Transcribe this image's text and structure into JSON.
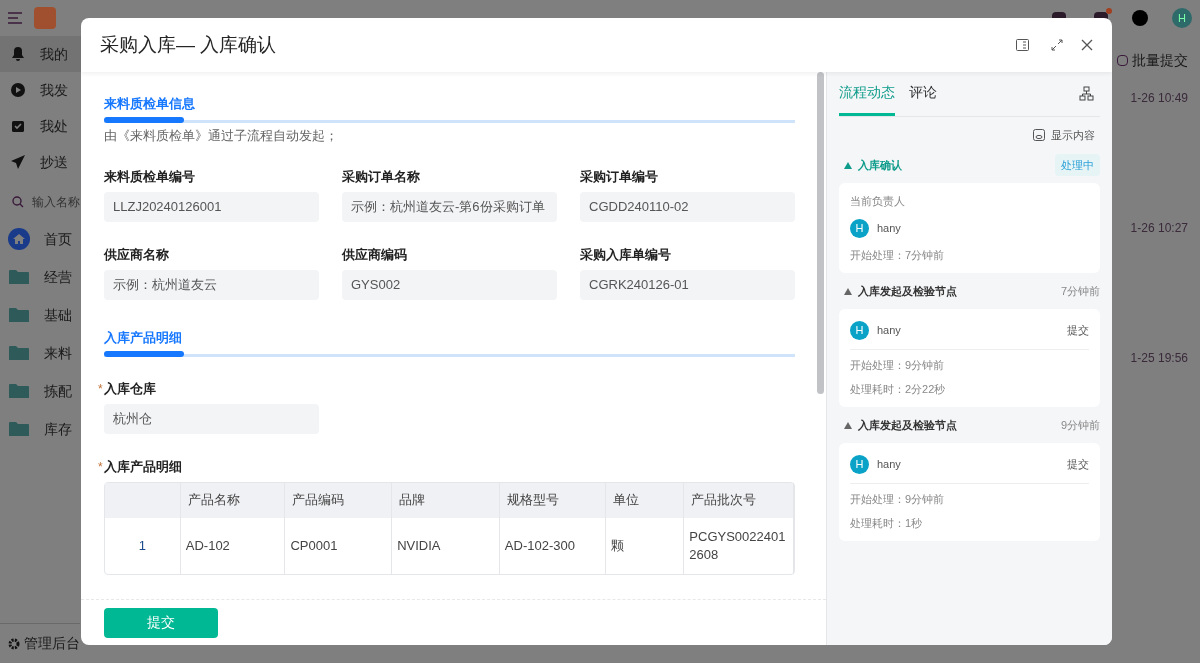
{
  "app": {
    "batch_submit": "批量提交",
    "avatar": "H",
    "nav": [
      {
        "label": "我的",
        "kind": "bell",
        "selected": true
      },
      {
        "label": "我发",
        "kind": "play",
        "selected": false
      },
      {
        "label": "我处",
        "kind": "check",
        "selected": false
      },
      {
        "label": "抄送",
        "kind": "send",
        "selected": false
      }
    ],
    "search": {
      "placeholder": "输入名称"
    },
    "menu": [
      {
        "label": "首页",
        "kind": "home"
      },
      {
        "label": "经营",
        "kind": "folder"
      },
      {
        "label": "基础",
        "kind": "folder"
      },
      {
        "label": "来料",
        "kind": "folder"
      },
      {
        "label": "拣配",
        "kind": "folder"
      },
      {
        "label": "库存",
        "kind": "folder"
      }
    ],
    "admin": "管理后台",
    "times": [
      "1-26 10:49",
      "1-26 10:27",
      "1-25 19:56"
    ]
  },
  "dialog": {
    "title": "采购入库— 入库确认",
    "sections": [
      {
        "title": "来料质检单信息",
        "note": "由《来料质检单》通过子流程自动发起；",
        "fields": [
          {
            "label": "来料质检单编号",
            "value": "LLZJ20240126001"
          },
          {
            "label": "采购订单名称",
            "value": "示例：杭州道友云-第6份采购订单"
          },
          {
            "label": "采购订单编号",
            "value": "CGDD240110-02"
          },
          {
            "label": "供应商名称",
            "value": "示例：杭州道友云"
          },
          {
            "label": "供应商编码",
            "value": "GYS002"
          },
          {
            "label": "采购入库单编号",
            "value": "CGRK240126-01"
          }
        ]
      },
      {
        "title": "入库产品明细",
        "fields": [
          {
            "label": "入库仓库",
            "value": "杭州仓",
            "mark": "*"
          }
        ]
      }
    ],
    "table": {
      "label": "入库产品明细",
      "mark": "*",
      "columns": [
        "产品名称",
        "产品编码",
        "品牌",
        "规格型号",
        "单位",
        "产品批次号"
      ],
      "rows": [
        {
          "index": "1",
          "cells": [
            "AD-102",
            "CP0001",
            "NVIDIA",
            "AD-102-300",
            "颗",
            "PCGYS00224012608"
          ]
        }
      ]
    },
    "submit": "提交",
    "side": {
      "tabs": [
        {
          "label": "流程动态",
          "selected": true
        },
        {
          "label": "评论",
          "selected": false
        }
      ],
      "show_content": "显示内容",
      "steps": [
        {
          "title": "入库确认",
          "current": true,
          "status": "处理中",
          "owner_label": "当前负责人",
          "user": "hany",
          "avatar": "H",
          "lines": [
            "开始处理：7分钟前"
          ]
        },
        {
          "title": "入库发起及检验节点",
          "current": false,
          "time": "7分钟前",
          "user": "hany",
          "avatar": "H",
          "action": "提交",
          "lines": [
            "开始处理：9分钟前",
            "处理耗时：2分22秒"
          ]
        },
        {
          "title": "入库发起及检验节点",
          "current": false,
          "time": "9分钟前",
          "user": "hany",
          "avatar": "H",
          "action": "提交",
          "lines": [
            "开始处理：9分钟前",
            "处理耗时：1秒"
          ]
        }
      ]
    }
  }
}
